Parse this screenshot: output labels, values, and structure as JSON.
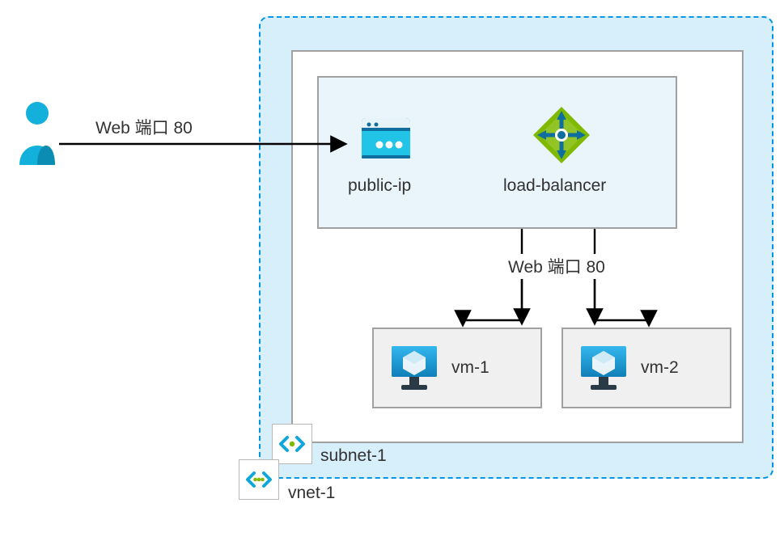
{
  "edges": {
    "user_to_publicip": "Web 端口 80",
    "lb_to_vms": "Web 端口 80"
  },
  "nodes": {
    "public_ip": "public-ip",
    "load_balancer": "load-balancer",
    "vm1": "vm-1",
    "vm2": "vm-2"
  },
  "containers": {
    "subnet": "subnet-1",
    "vnet": "vnet-1"
  },
  "colors": {
    "azure_blue": "#0fa7d9",
    "azure_deep": "#0067a0",
    "lb_green": "#7fba00",
    "dashed_border": "#0095e6",
    "panel_bg": "#d7eefb",
    "inner_bg": "#e9f4fb",
    "vm_bg": "#f0f0f0",
    "border_gray": "#a0a0a0"
  }
}
